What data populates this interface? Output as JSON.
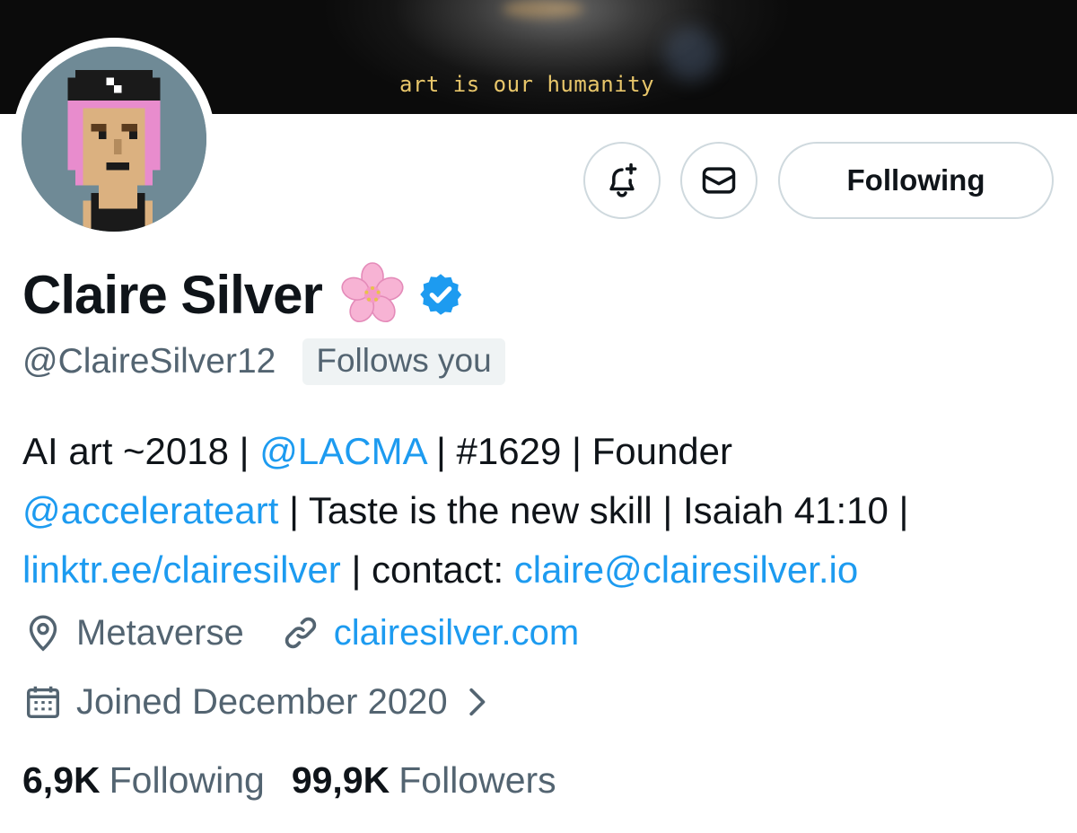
{
  "banner": {
    "caption": "art is our humanity"
  },
  "profile": {
    "name": "Claire Silver",
    "handle": "@ClaireSilver12",
    "follows_you": "Follows you",
    "bio": {
      "part1": "AI art ~2018 | ",
      "mention1": "@LACMA",
      "part2": " | #1629 | Founder",
      "mention2": "@accelerateart",
      "part3": " | Taste is the new skill | Isaiah 41:10 |",
      "link1": "linktr.ee/clairesilver",
      "part4": " | contact: ",
      "email": "claire@clairesilver.io"
    },
    "location": "Metaverse",
    "website": "clairesilver.com",
    "joined": "Joined December 2020",
    "following_count": "6,9K",
    "following_label": "Following",
    "followers_count": "99,9K",
    "followers_label": "Followers"
  },
  "actions": {
    "follow_state": "Following"
  },
  "icons": {
    "notify": "bell-plus-icon",
    "message": "envelope-icon",
    "emoji": "cherry-blossom-icon",
    "verified": "verified-badge-icon",
    "location": "location-pin-icon",
    "link": "link-icon",
    "calendar": "calendar-icon",
    "chevron": "chevron-right-icon"
  },
  "colors": {
    "link": "#1d9bf0",
    "secondary_text": "#536471",
    "primary_text": "#0f1419",
    "border": "#cfd9de"
  }
}
